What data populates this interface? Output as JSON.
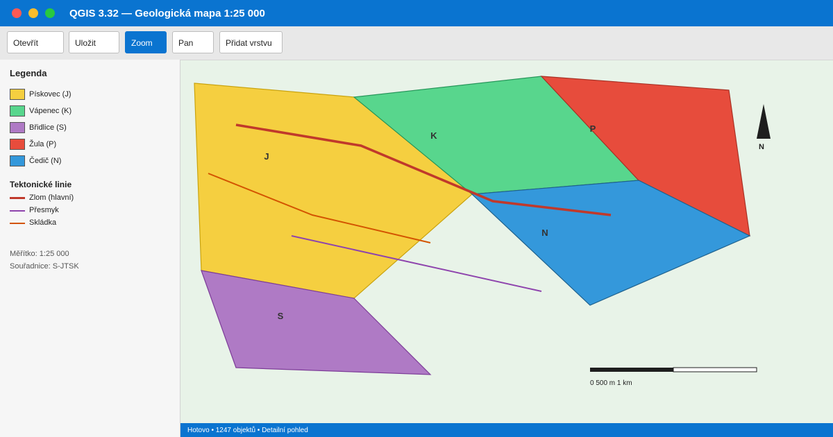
{
  "window": {
    "title": "QGIS 3.32 — Geologická mapa 1:25 000"
  },
  "toolbar": {
    "buttons": [
      {
        "label": "Otevřít",
        "active": false
      },
      {
        "label": "Uložit",
        "active": false
      },
      {
        "label": "Zoom",
        "active": true
      },
      {
        "label": "Pan",
        "active": false
      },
      {
        "label": "Přidat vrstvu",
        "active": false
      }
    ]
  },
  "legend": {
    "title": "Legenda",
    "units": [
      {
        "label": "Pískovec (J)",
        "color": "#f5cf40"
      },
      {
        "label": "Vápenec (K)",
        "color": "#58d68d"
      },
      {
        "label": "Břidlice (S)",
        "color": "#af7ac5"
      },
      {
        "label": "Žula (P)",
        "color": "#e74c3c"
      },
      {
        "label": "Čedič (N)",
        "color": "#3498db"
      }
    ],
    "tectonic_title": "Tektonické linie",
    "lines": [
      {
        "label": "Zlom (hlavní)",
        "color": "#c0392b"
      },
      {
        "label": "Přesmyk",
        "color": "#8e44ad"
      },
      {
        "label": "Skládka",
        "color": "#d35400"
      }
    ],
    "scale_text": "Měřítko: 1:25 000",
    "coords_text": "Souřadnice: S-JTSK"
  },
  "map": {
    "units": [
      {
        "code": "J",
        "fill": "#f5cf40",
        "stroke": "#c9a30e"
      },
      {
        "code": "K",
        "fill": "#58d68d",
        "stroke": "#27965a"
      },
      {
        "code": "P",
        "fill": "#e74c3c",
        "stroke": "#a93226"
      },
      {
        "code": "N",
        "fill": "#3498db",
        "stroke": "#1f618d"
      },
      {
        "code": "S",
        "fill": "#af7ac5",
        "stroke": "#7d3c98"
      }
    ],
    "north_label": "N",
    "scale_label": "0 500 m 1 km"
  },
  "status": {
    "text": "Hotovo • 1247 objektů • Detailní pohled"
  }
}
